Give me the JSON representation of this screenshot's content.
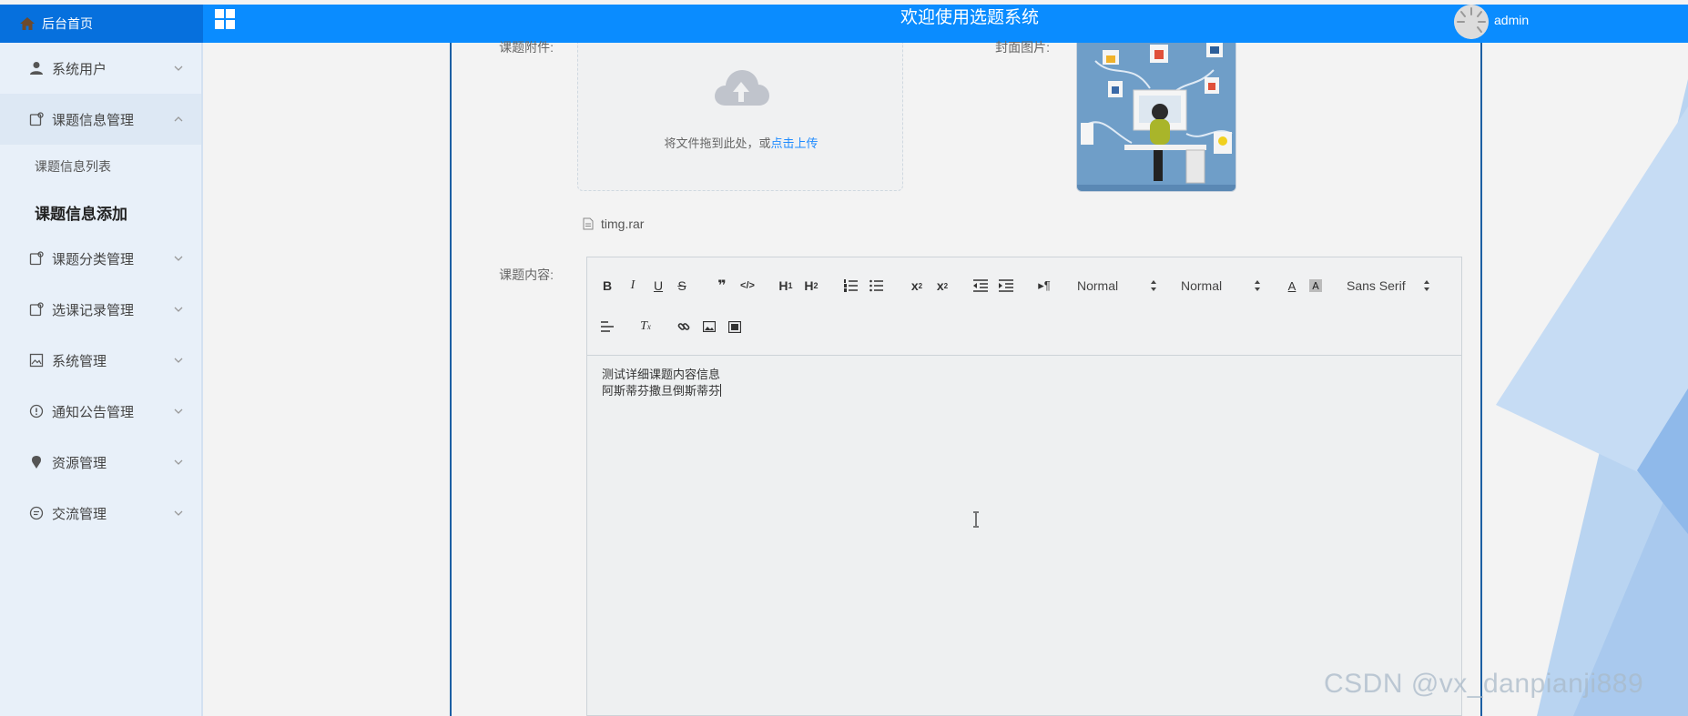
{
  "header": {
    "home_label": "后台首页",
    "title": "欢迎使用选题系统",
    "username": "admin"
  },
  "sidebar": {
    "items": [
      {
        "label": "系统用户",
        "icon": "user-icon"
      },
      {
        "label": "课题信息管理",
        "icon": "doc-icon",
        "open": true
      },
      {
        "label": "课题分类管理",
        "icon": "doc-icon"
      },
      {
        "label": "选课记录管理",
        "icon": "doc-icon"
      },
      {
        "label": "系统管理",
        "icon": "image-icon"
      },
      {
        "label": "通知公告管理",
        "icon": "info-icon"
      },
      {
        "label": "资源管理",
        "icon": "pin-icon"
      },
      {
        "label": "交流管理",
        "icon": "chat-icon"
      }
    ],
    "subitems": [
      {
        "label": "课题信息列表"
      },
      {
        "label": "课题信息添加",
        "active": true
      }
    ]
  },
  "form": {
    "attachment_label": "课题附件:",
    "cover_label": "封面图片:",
    "content_label": "课题内容:",
    "upload_hint": "将文件拖到此处，或",
    "upload_link": "点击上传",
    "file_name": "timg.rar"
  },
  "editor": {
    "selects": {
      "header_size": "Normal",
      "text_size": "Normal",
      "font": "Sans Serif"
    },
    "content_lines": [
      "测试详细课题内容信息",
      "阿斯蒂芬撒旦倒斯蒂芬"
    ]
  },
  "watermark": "CSDN @vx_danpianji889",
  "colors": {
    "topbar": "#0a8cff",
    "home_bg": "#0670dd",
    "sidebar": "#e8f0f9",
    "frame_border": "#1c5fa3",
    "link": "#1e8bff"
  }
}
